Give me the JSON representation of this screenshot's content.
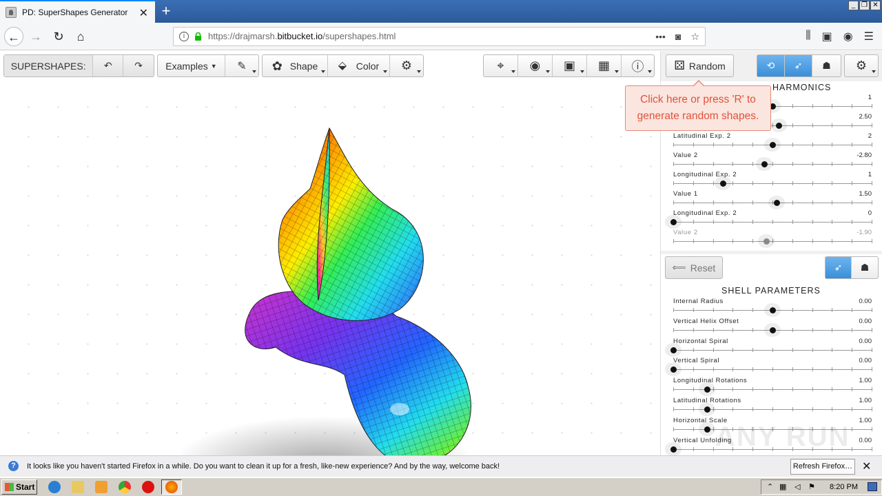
{
  "browser": {
    "tab_title": "PD: SuperShapes Generator",
    "tab_close": "✕",
    "new_tab": "+",
    "url_prefix": "https://drajmarsh.",
    "url_domain": "bitbucket.io",
    "url_path": "/supershapes.html",
    "url_more": "•••"
  },
  "toolbar": {
    "app_label": "SUPERSHAPES:",
    "examples_label": "Examples",
    "shape_label": "Shape",
    "color_label": "Color",
    "random_label": "Random"
  },
  "tooltip": {
    "text": "Click here or press 'R' to generate random shapes."
  },
  "harmonics": {
    "title": "HARMONICS",
    "sliders": [
      {
        "label": "",
        "value": "1",
        "position": 0.5,
        "dim": false
      },
      {
        "label": "",
        "value": "2.50",
        "position": 0.53,
        "dim": false
      },
      {
        "label": "Latitudinal Exp. 2",
        "value": "2",
        "position": 0.5,
        "dim": false
      },
      {
        "label": "Value 2",
        "value": "-2.80",
        "position": 0.46,
        "dim": false
      },
      {
        "label": "Longitudinal Exp. 2",
        "value": "1",
        "position": 0.25,
        "dim": false
      },
      {
        "label": "Value 1",
        "value": "1.50",
        "position": 0.52,
        "dim": false
      },
      {
        "label": "Longitudinal Exp. 2",
        "value": "0",
        "position": 0.0,
        "dim": false
      },
      {
        "label": "Value 2",
        "value": "-1.90",
        "position": 0.47,
        "dim": true
      }
    ]
  },
  "shell": {
    "reset_label": "Reset",
    "title": "SHELL PARAMETERS",
    "sliders": [
      {
        "label": "Internal Radius",
        "value": "0.00",
        "position": 0.5
      },
      {
        "label": "Vertical Helix Offset",
        "value": "0.00",
        "position": 0.5
      },
      {
        "label": "Horizontal Spiral",
        "value": "0.00",
        "position": 0.0
      },
      {
        "label": "Vertical Spiral",
        "value": "0.00",
        "position": 0.0
      },
      {
        "label": "Longitudinal Rotations",
        "value": "1.00",
        "position": 0.17
      },
      {
        "label": "Latitudinal Rotations",
        "value": "1.00",
        "position": 0.17
      },
      {
        "label": "Horizontal Scale",
        "value": "1.00",
        "position": 0.17
      },
      {
        "label": "Vertical Unfolding",
        "value": "0.00",
        "position": 0.0
      }
    ]
  },
  "notification": {
    "message": "It looks like you haven't started Firefox in a while. Do you want to clean it up for a fresh, like-new experience? And by the way, welcome back!",
    "button": "Refresh Firefox…",
    "close": "✕"
  },
  "taskbar": {
    "start": "Start",
    "clock": "8:20 PM"
  },
  "watermark": "ANY RUN"
}
